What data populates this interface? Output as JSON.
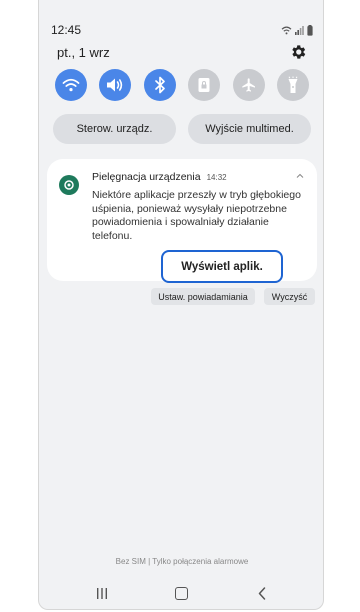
{
  "status_bar": {
    "time": "12:45"
  },
  "header": {
    "date": "pt., 1 wrz"
  },
  "quick_settings": {
    "toggles": [
      {
        "name": "wifi",
        "state": "on"
      },
      {
        "name": "sound",
        "state": "on"
      },
      {
        "name": "bluetooth",
        "state": "on"
      },
      {
        "name": "screen-lock-rotation",
        "state": "off"
      },
      {
        "name": "airplane-mode",
        "state": "off"
      },
      {
        "name": "flashlight",
        "state": "off"
      }
    ],
    "device_control_label": "Sterow. urządz.",
    "media_output_label": "Wyjście multimed."
  },
  "notification": {
    "app": "Pielęgnacja urządzenia",
    "time": "14:32",
    "body": "Niektóre aplikacje przeszły w tryb głębokiego uśpienia, ponieważ wysyłały niepotrzebne powiadomienia i spowalniały działanie telefonu.",
    "action_label": "Wyświetl aplik."
  },
  "actions": {
    "settings_label": "Ustaw. powiadamiania",
    "clear_label": "Wyczyść"
  },
  "footer": {
    "sim_status": "Bez SIM | Tylko połączenia alarmowe"
  },
  "colors": {
    "accent": "#4a86e8",
    "highlight": "#1e64d2",
    "notif_icon": "#1e7a5c"
  }
}
